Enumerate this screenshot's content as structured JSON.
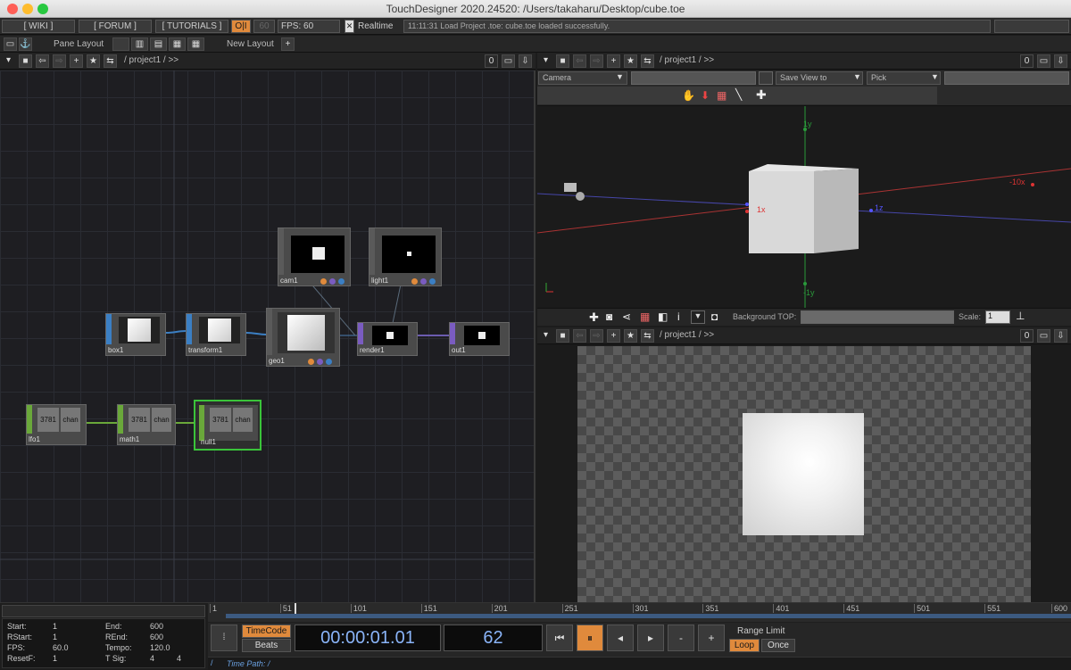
{
  "window": {
    "title": "TouchDesigner 2020.24520: /Users/takaharu/Desktop/cube.toe"
  },
  "topbar": {
    "wiki": "[ WIKI ]",
    "forum": "[ FORUM ]",
    "tutorials": "[ TUTORIALS ]",
    "oi": "O|I",
    "fps_target": "60",
    "fps_label": "FPS:  60",
    "realtime_label": "Realtime",
    "realtime_checked": "✕",
    "console": "11:11:31 Load Project .toe: cube.toe loaded successfully."
  },
  "panebar": {
    "pane_layout": "Pane Layout",
    "new_layout": "New Layout",
    "add": "+"
  },
  "network_pane": {
    "path": "/ project1 / >>",
    "count": "0"
  },
  "top_right_pane": {
    "path": "/ project1 / >>",
    "count": "0"
  },
  "bottom_right_pane": {
    "path": "/ project1 / >>",
    "count": "0"
  },
  "viewer3d": {
    "camera_select": "Camera",
    "save_view": "Save View to",
    "pick": "Pick",
    "bg_top_label": "Background TOP:",
    "scale_label": "Scale:",
    "scale_value": "1",
    "axis_labels": {
      "y_top": "1y",
      "y_bottom": "-1y",
      "x_pos": "1x",
      "x_neg": "-10x",
      "z": "1z"
    }
  },
  "nodes": {
    "cam1": "cam1",
    "light1": "light1",
    "box1": "box1",
    "transform1": "transform1",
    "geo1": "geo1",
    "render1": "render1",
    "out1": "out1",
    "lfo1": "lfo1",
    "math1": "math1",
    "null1": "null1",
    "chop_value": "3781",
    "chop_chan": "chan"
  },
  "timeline": {
    "start_label": "Start:",
    "start": "1",
    "end_label": "End:",
    "end": "600",
    "rstart_label": "RStart:",
    "rstart": "1",
    "rend_label": "REnd:",
    "rend": "600",
    "fps_label": "FPS:",
    "fps": "60.0",
    "tempo_label": "Tempo:",
    "tempo": "120.0",
    "resetf_label": "ResetF:",
    "resetf": "1",
    "tsig_label": "T Sig:",
    "tsig_a": "4",
    "tsig_b": "4",
    "timecode": "TimeCode",
    "beats": "Beats",
    "clock": "00:00:01.01",
    "frame": "62",
    "range_limit": "Range Limit",
    "loop": "Loop",
    "once": "Once",
    "time_path": "Time Path: /",
    "ruler": [
      "1",
      "51",
      "101",
      "151",
      "201",
      "251",
      "301",
      "351",
      "401",
      "451",
      "501",
      "551",
      "600"
    ],
    "current_frame_fraction": 0.1
  },
  "colors": {
    "accent": "#e08a3c",
    "sop": "#3b7fc4",
    "top": "#7a5cc0",
    "chop": "#6aa83a",
    "comp": "#8a8a8a"
  }
}
